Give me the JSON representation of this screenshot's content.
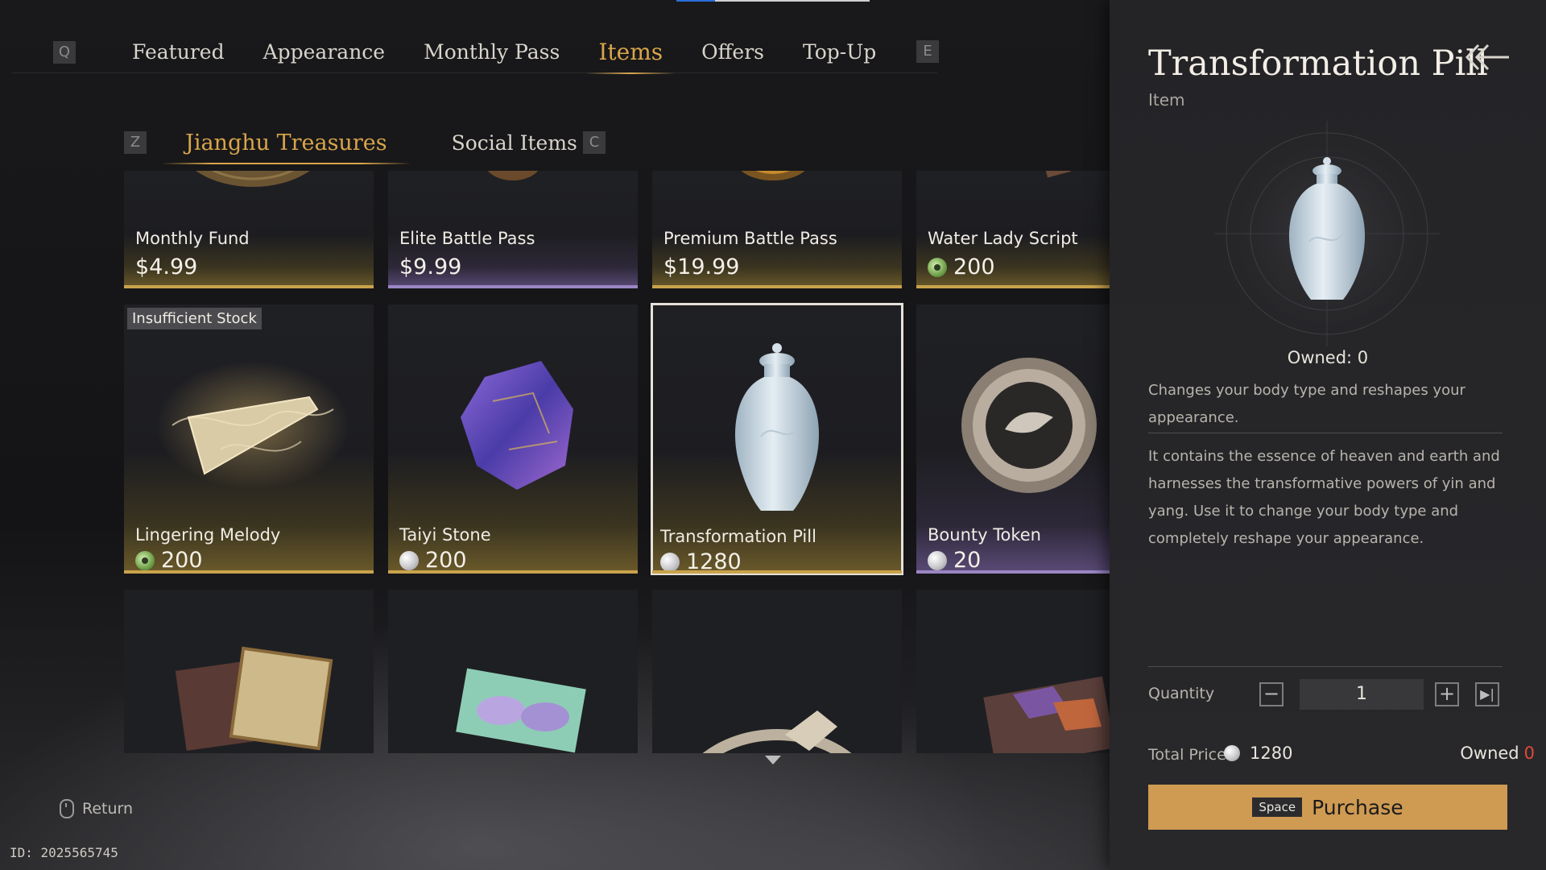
{
  "top_tabs": {
    "left_key": "Q",
    "right_key": "E",
    "items": [
      "Featured",
      "Appearance",
      "Monthly Pass",
      "Items",
      "Offers",
      "Top-Up"
    ],
    "active": "Items"
  },
  "sub_tabs": {
    "left_key": "Z",
    "right_key": "C",
    "items": [
      "Jianghu Treasures",
      "Social Items"
    ],
    "active": "Jianghu Treasures"
  },
  "items_row1": [
    {
      "name": "Monthly Fund",
      "price": "$4.99"
    },
    {
      "name": "Elite Battle Pass",
      "price": "$9.99"
    },
    {
      "name": "Premium Battle Pass",
      "price": "$19.99"
    },
    {
      "name": "Water Lady Script",
      "price": "200",
      "currency": "jade"
    }
  ],
  "items_row2": [
    {
      "name": "Lingering Melody",
      "price": "200",
      "currency": "jade",
      "badge": "Insufficient Stock"
    },
    {
      "name": "Taiyi Stone",
      "price": "200",
      "currency": "pearl"
    },
    {
      "name": "Transformation Pill",
      "price": "1280",
      "currency": "pearl",
      "selected": true
    },
    {
      "name": "Bounty Token",
      "price": "20",
      "currency": "pearl"
    }
  ],
  "footer": {
    "return_label": "Return",
    "player_id": "ID: 2025565745"
  },
  "detail": {
    "title": "Transformation Pill",
    "type": "Item",
    "owned_line": "Owned: 0",
    "short_desc": "Changes your body type and reshapes your appearance.",
    "long_desc": "It contains the essence of heaven and earth and harnesses the transformative powers of yin and yang. Use it to change your body type and completely reshape your appearance.",
    "quantity_label": "Quantity",
    "quantity": "1",
    "total_label": "Total Price",
    "total": "1280",
    "owned_label": "Owned",
    "owned_value": "0",
    "purchase_key": "Space",
    "purchase_label": "Purchase"
  },
  "colors": {
    "accent_gold": "#d9a54a",
    "purchase_button": "#cf9a52",
    "owned_zero": "#e04a3a"
  }
}
